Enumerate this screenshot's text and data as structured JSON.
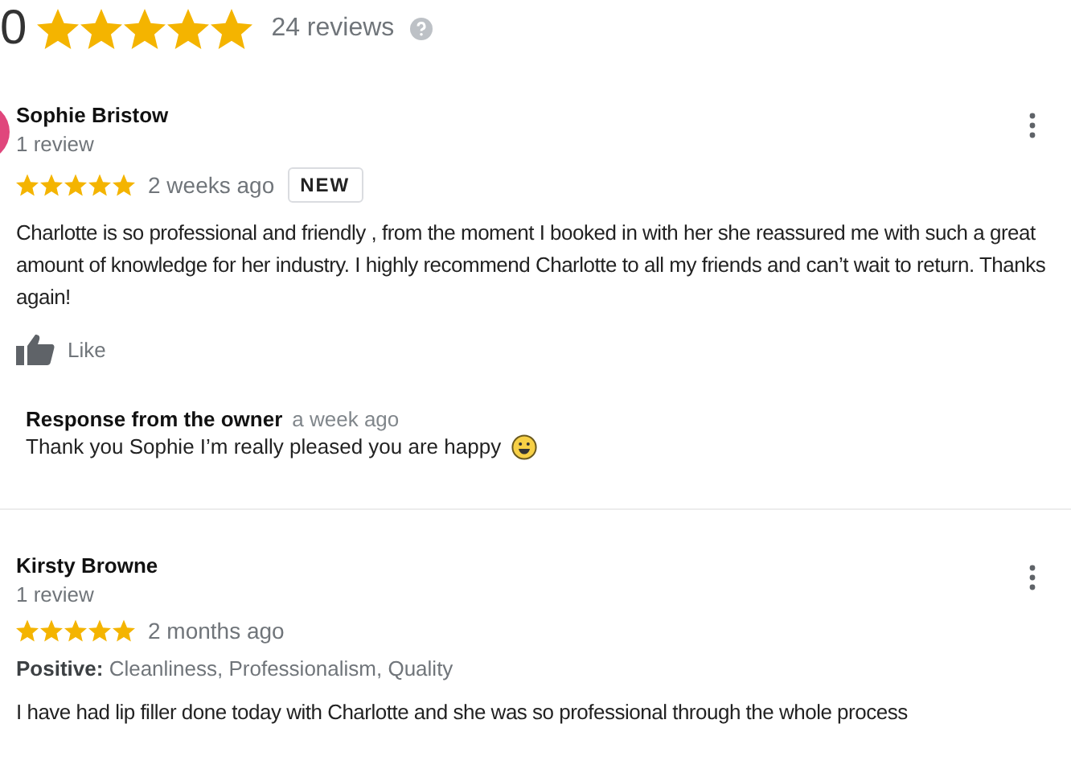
{
  "summary": {
    "rating": "0",
    "stars": 5,
    "count": "24 reviews"
  },
  "reviews": [
    {
      "author": "Sophie Bristow",
      "avatar": true,
      "author_meta": "1 review",
      "stars": 5,
      "time": "2 weeks ago",
      "badge": "NEW",
      "text": "Charlotte is so professional and friendly , from the moment I booked in with her she reassured me with such a great amount of knowledge for her industry.  I highly recommend Charlotte to all my friends and can’t wait to return. Thanks again!",
      "like": "Like",
      "owner_response": {
        "title": "Response from the owner",
        "time": "a week ago",
        "text": "Thank you Sophie I’m really pleased you are happy"
      }
    },
    {
      "author": "Kirsty Browne",
      "avatar": false,
      "author_meta": "1 review",
      "stars": 5,
      "time": "2 months ago",
      "highlights": {
        "label": "Positive:",
        "text": "Cleanliness, Professionalism, Quality"
      },
      "text": "I have had lip filler done today with Charlotte and she was so professional through the whole process"
    }
  ]
}
